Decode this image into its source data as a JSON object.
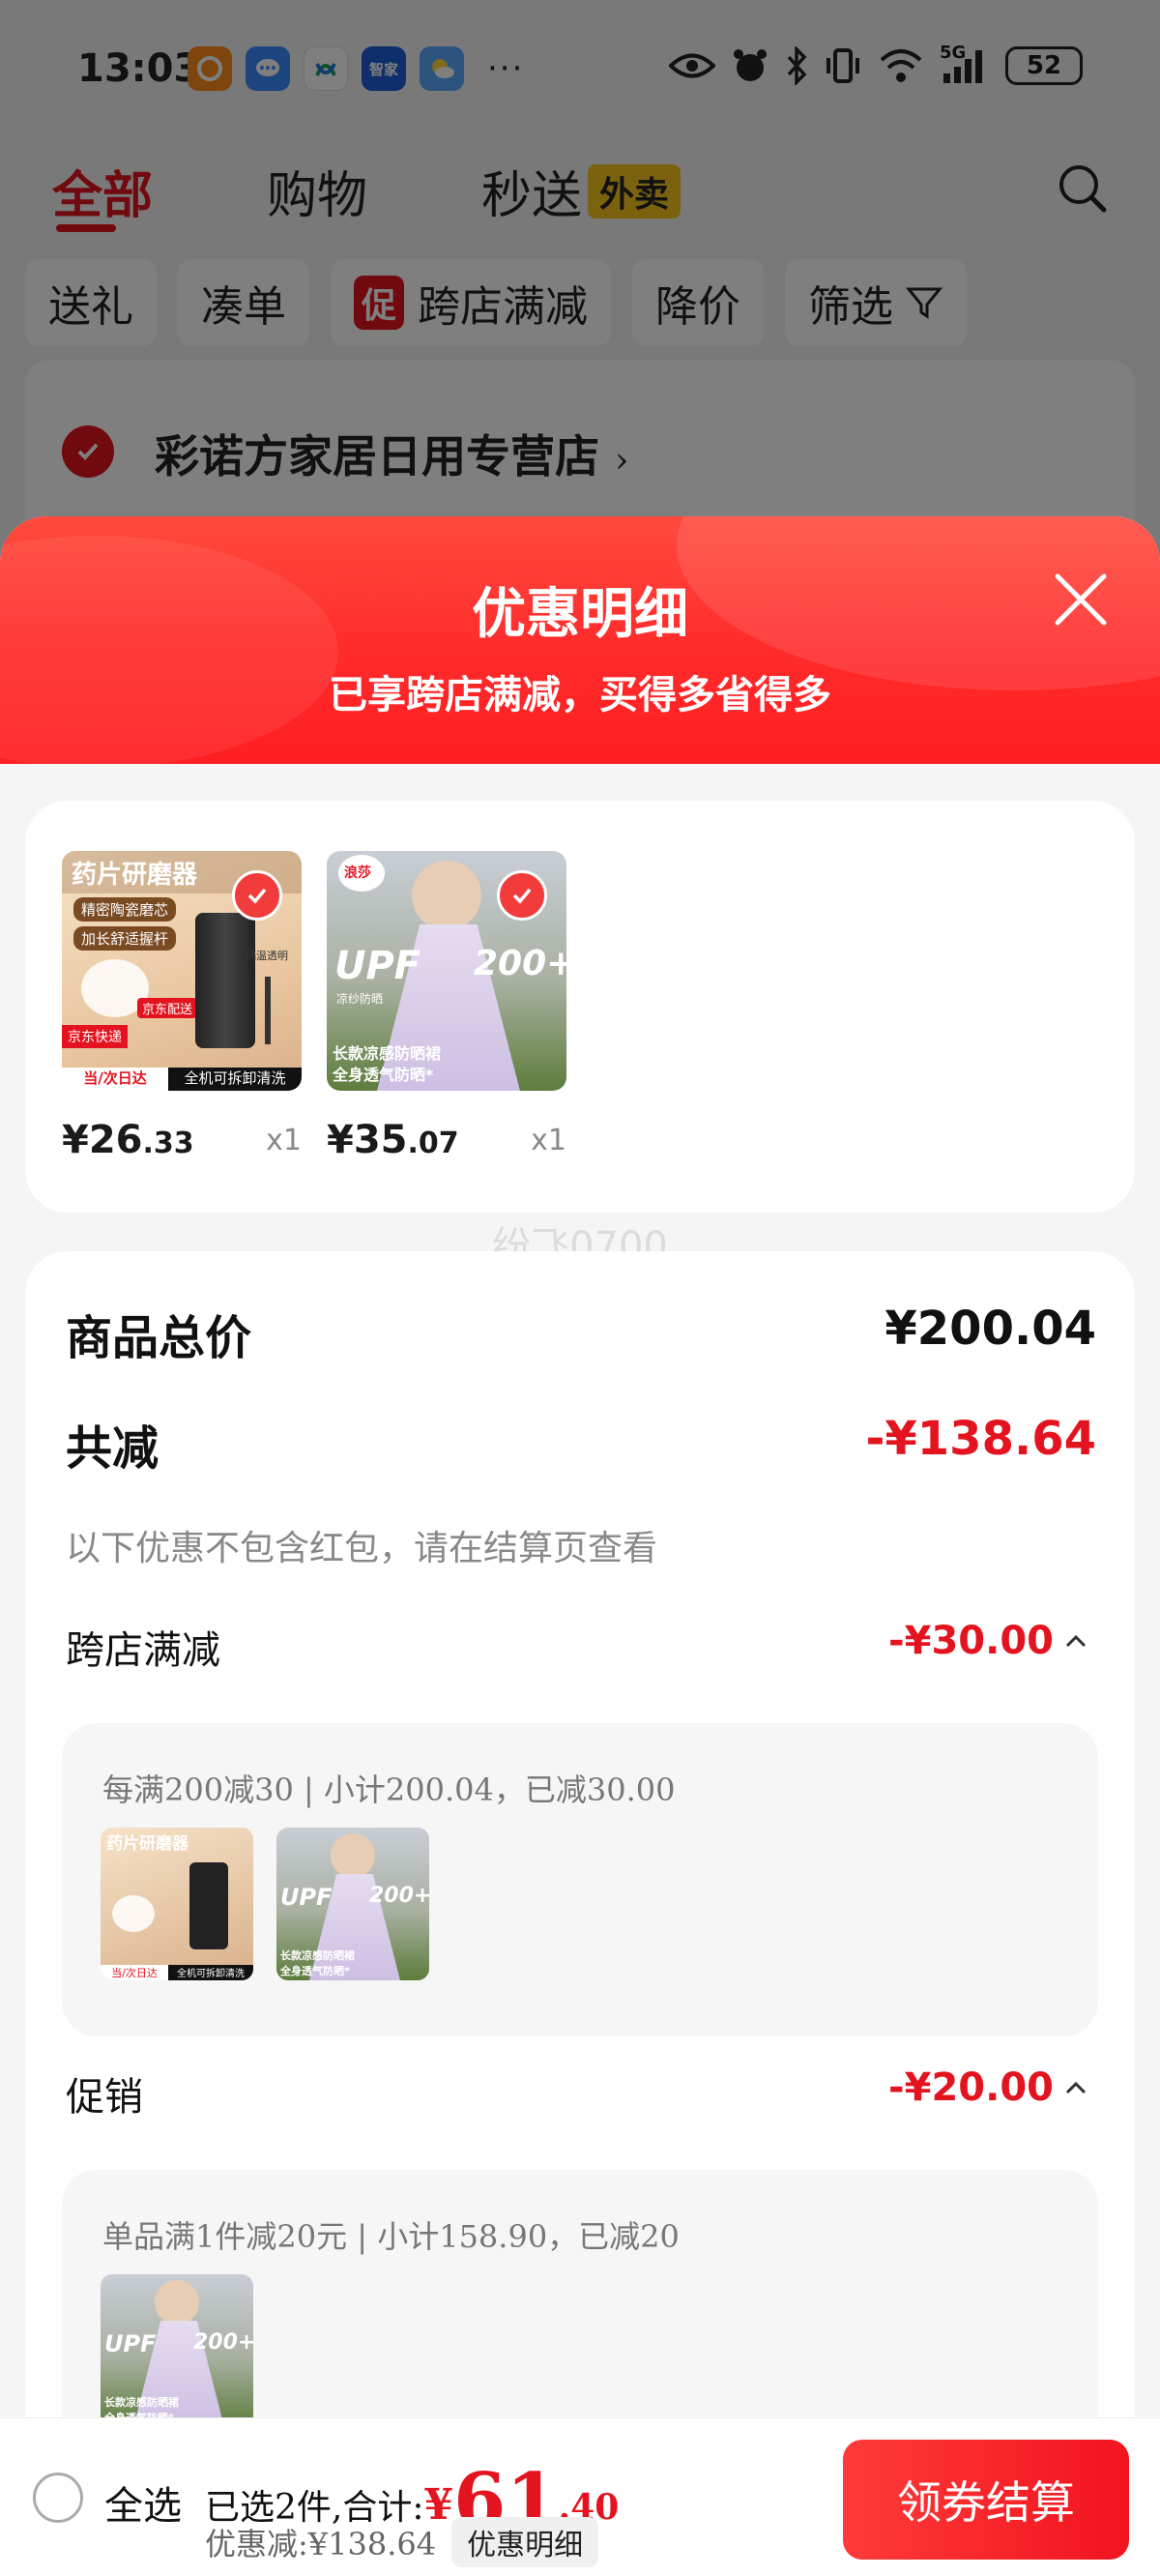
{
  "statusbar": {
    "time": "13:03",
    "battery": "52",
    "network": "5G",
    "app_icons": [
      "shopping-app-icon",
      "message-icon",
      "mobile-app-icon",
      "smart-home-icon",
      "weather-icon"
    ],
    "overflow": "···",
    "haier_label": "智家"
  },
  "topnav": {
    "tabs": [
      "全部",
      "购物",
      "秒送"
    ],
    "waimai_badge": "外卖"
  },
  "chips": {
    "gift": "送礼",
    "bundle": "凑单",
    "promo_tag": "促",
    "cross_store": "跨店满减",
    "price_drop": "降价",
    "filter": "筛选"
  },
  "store": {
    "name": "彩诺方家居日用专营店",
    "chevron": "›"
  },
  "sheet": {
    "title": "优惠明细",
    "subtitle": "已享跨店满减，买得多省得多"
  },
  "goods": [
    {
      "price_int": "¥26",
      "price_dec": ".33",
      "qty": "x1",
      "img_title": "药片研磨器",
      "img_sub1": "精密陶瓷磨芯",
      "img_sub2": "加长舒适握杆",
      "img_badge": "京东快递",
      "img_badge2": "当/次日达",
      "img_bottom": "全机可拆卸清洗",
      "img_tag": "隔温透明",
      "img_stamp": "京东配送"
    },
    {
      "price_int": "¥35",
      "price_dec": ".07",
      "qty": "x1",
      "img_title": "UPF",
      "img_title2": "200+",
      "img_sub": "凉纱防晒",
      "img_bottom1": "长款凉感防晒裙",
      "img_bottom2": "全身透气防晒*",
      "img_brand": "浪莎"
    }
  ],
  "watermark": "纷飞0700",
  "summary": {
    "total_label": "商品总价",
    "total_value": "¥200.04",
    "reduce_label": "共减",
    "reduce_value": "-¥138.64",
    "note": "以下优惠不包含红包，请在结算页查看"
  },
  "sections": [
    {
      "title": "跨店满减",
      "amount": "-¥30.00",
      "detail": "每满200减30 | 小计200.04，已减30.00"
    },
    {
      "title": "促销",
      "amount": "-¥20.00",
      "detail": "单品满1件减20元 | 小计158.90，已减20"
    }
  ],
  "bottom": {
    "select_all": "全选",
    "selected_text": "已选2件,合计:",
    "yen": "¥",
    "amount_int": "61",
    "amount_dec": ".40",
    "discount_text": "优惠减:¥138.64",
    "detail_btn": "优惠明细",
    "checkout": "领券结算"
  },
  "colors": {
    "accent_red": "#e3141f",
    "header_red": "#ff2b2b",
    "waimai_yellow": "#f4c51e"
  }
}
